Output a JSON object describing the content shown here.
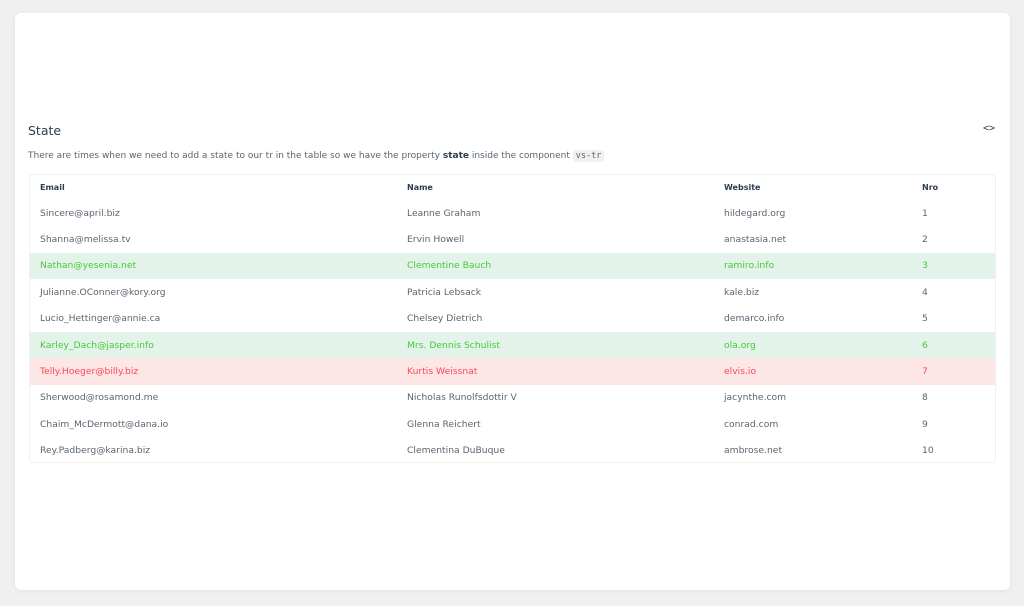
{
  "section": {
    "title": "State",
    "code_toggle_icon": "code-icon",
    "description_prefix": "There are times when we need to add a state to our tr in the table so we have the property ",
    "description_property": "state",
    "description_middle": " inside the component ",
    "description_component": "vs-tr"
  },
  "table": {
    "headers": {
      "email": "Email",
      "name": "Name",
      "website": "Website",
      "nro": "Nro"
    },
    "rows": [
      {
        "email": "Sincere@april.biz",
        "name": "Leanne Graham",
        "website": "hildegard.org",
        "nro": "1",
        "state": ""
      },
      {
        "email": "Shanna@melissa.tv",
        "name": "Ervin Howell",
        "website": "anastasia.net",
        "nro": "2",
        "state": ""
      },
      {
        "email": "Nathan@yesenia.net",
        "name": "Clementine Bauch",
        "website": "ramiro.info",
        "nro": "3",
        "state": "success"
      },
      {
        "email": "Julianne.OConner@kory.org",
        "name": "Patricia Lebsack",
        "website": "kale.biz",
        "nro": "4",
        "state": ""
      },
      {
        "email": "Lucio_Hettinger@annie.ca",
        "name": "Chelsey Dietrich",
        "website": "demarco.info",
        "nro": "5",
        "state": ""
      },
      {
        "email": "Karley_Dach@jasper.info",
        "name": "Mrs. Dennis Schulist",
        "website": "ola.org",
        "nro": "6",
        "state": "success"
      },
      {
        "email": "Telly.Hoeger@billy.biz",
        "name": "Kurtis Weissnat",
        "website": "elvis.io",
        "nro": "7",
        "state": "danger"
      },
      {
        "email": "Sherwood@rosamond.me",
        "name": "Nicholas Runolfsdottir V",
        "website": "jacynthe.com",
        "nro": "8",
        "state": ""
      },
      {
        "email": "Chaim_McDermott@dana.io",
        "name": "Glenna Reichert",
        "website": "conrad.com",
        "nro": "9",
        "state": ""
      },
      {
        "email": "Rey.Padberg@karina.biz",
        "name": "Clementina DuBuque",
        "website": "ambrose.net",
        "nro": "10",
        "state": ""
      }
    ]
  },
  "colors": {
    "success_text": "#46c93a",
    "success_bg": "#e4f3e9",
    "danger_text": "#ff4757",
    "danger_bg": "#fce6e6"
  }
}
